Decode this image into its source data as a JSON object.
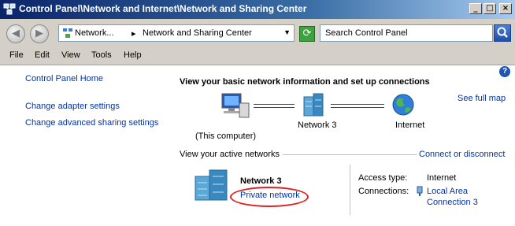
{
  "window": {
    "title": "Control Panel\\Network and Internet\\Network and Sharing Center",
    "minimize": "_",
    "maximize": "□",
    "close": "×"
  },
  "address": {
    "crumb1": "Network...",
    "crumb2": "Network and Sharing Center",
    "back": "◀",
    "forward": "▶",
    "refresh": "⟳"
  },
  "search": {
    "placeholder": "Search Control Panel"
  },
  "menu": {
    "file": "File",
    "edit": "Edit",
    "view": "View",
    "tools": "Tools",
    "help": "Help"
  },
  "sidebar": {
    "home": "Control Panel Home",
    "adapter": "Change adapter settings",
    "advanced": "Change advanced sharing settings"
  },
  "main": {
    "heading": "View your basic network information and set up connections",
    "see_full_map": "See full map",
    "computer_label": "(This computer)",
    "network_label": "Network  3",
    "internet_label": "Internet",
    "active_networks": "View your active networks",
    "connect_disconnect": "Connect or disconnect",
    "network_name": "Network  3",
    "network_type": "Private network",
    "access_type_label": "Access type:",
    "access_type_value": "Internet",
    "connections_label": "Connections:",
    "connection_line1": "Local Area",
    "connection_line2": "Connection 3",
    "help": "?"
  }
}
